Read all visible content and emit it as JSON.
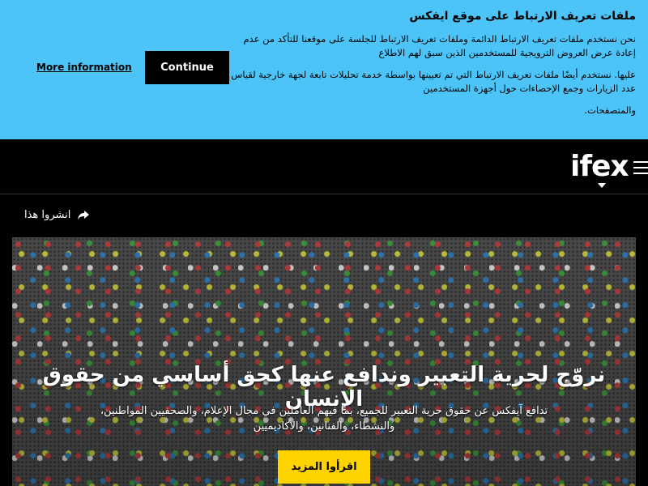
{
  "cookie_banner": {
    "title": "ملفات تعريف الارتباط على موقع ايفكس",
    "paragraph1": "نحن نستخدم ملفات تعريف الارتباط الدائمة وملفات تعريف الارتباط للجلسة على موقعنا للتأكد من عدم إعادة عرض العروض الترويجية للمستخدمين الذين سبق لهم الاطلاع",
    "paragraph2": "عليها. نستخدم أيضًا ملفات تعريف الارتباط التي تم تعيينها بواسطة خدمة تحليلات تابعة لجهة خارجية لقياس عدد الزيارات وجمع الإحصاءات حول أجهزة المستخدمين",
    "paragraph3": "والمتصفحات.",
    "more_info_label": "More information",
    "continue_label": "Continue",
    "background_color": "#4dc4f7"
  },
  "header": {
    "logo_text": "ifex",
    "menu_icon": "hamburger-icon"
  },
  "share": {
    "label": "انشروا هذا",
    "icon": "share-arrow-icon"
  },
  "hero": {
    "title": "نروّج لحرية التعبير وندافع عنها كحق أساسي من حقوق الإنسان",
    "subtitle": "تدافع آيفكس عن حقوق حرية التعبير للجميع، بما فيهم العاملين في مجال الإعلام، والصحفيين المواطنين، والنشطاء، والفنانين، والأكاديميين",
    "button_label": "اقرأوا المزيد",
    "button_color": "#ffd300"
  }
}
